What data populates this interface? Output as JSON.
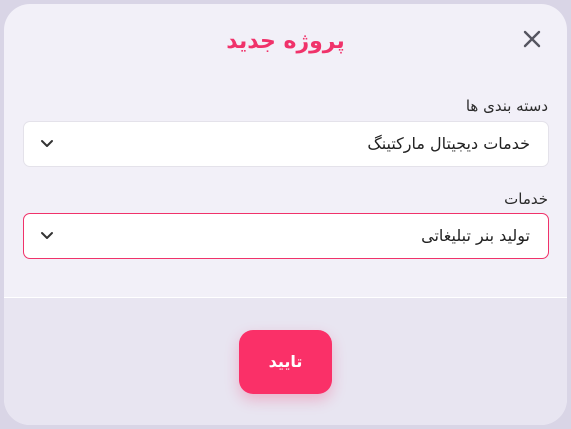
{
  "modal": {
    "title": "پروژه جدید",
    "close_icon": "close-icon"
  },
  "fields": {
    "category": {
      "label": "دسته بندی ها",
      "value": "خدمات دیجیتال مارکتینگ"
    },
    "service": {
      "label": "خدمات",
      "value": "تولید بنر تبلیغاتی"
    }
  },
  "footer": {
    "confirm_label": "تایید"
  },
  "colors": {
    "accent": "#f0326a",
    "modal_bg": "#f2f0f8",
    "footer_bg": "#e8e5f1"
  }
}
